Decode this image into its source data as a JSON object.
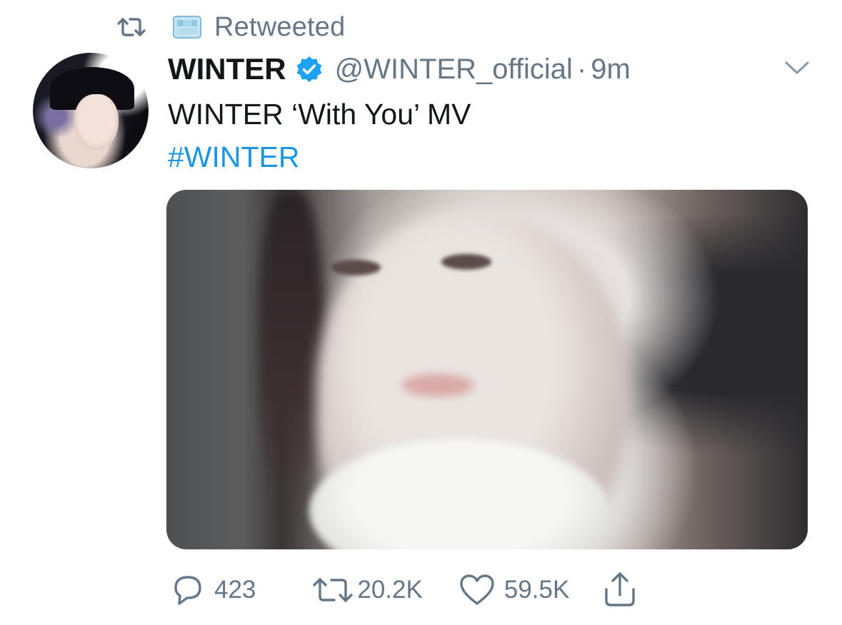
{
  "retweet": {
    "label": "Retweeted",
    "icon": "retweet-icon"
  },
  "author": {
    "name": "WINTER",
    "handle": "@WINTER_official",
    "separator": "·",
    "time": "9m",
    "verified": true
  },
  "tweet": {
    "text": "WINTER ‘With You’ MV",
    "hashtag": "#WINTER"
  },
  "actions": {
    "replies": "423",
    "retweets": "20.2K",
    "likes": "59.5K"
  },
  "colors": {
    "link": "#1b95e0",
    "secondary_text": "#657786",
    "primary_text": "#14171a",
    "verified_badge": "#1da1f2"
  }
}
